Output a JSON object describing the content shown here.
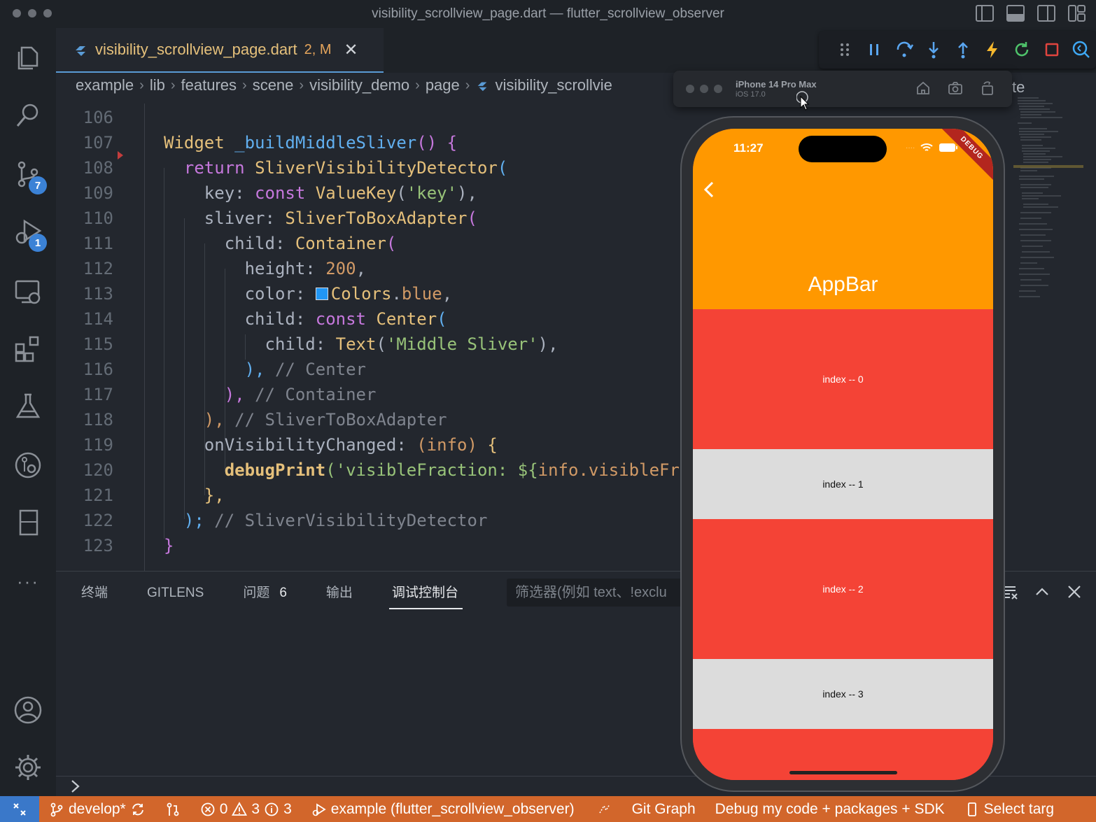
{
  "window": {
    "title": "visibility_scrollview_page.dart — flutter_scrollview_observer"
  },
  "activity_bar": {
    "source_control_badge": "7",
    "run_debug_badge": "1",
    "more": "···"
  },
  "tab": {
    "filename": "visibility_scrollview_page.dart",
    "status": "2, M",
    "close": "✕"
  },
  "breadcrumb": [
    "example",
    "lib",
    "features",
    "scene",
    "visibility_demo",
    "page",
    "visibility_scrollvie",
    "te"
  ],
  "code": {
    "line_numbers": [
      "106",
      "107",
      "108",
      "109",
      "110",
      "111",
      "112",
      "113",
      "114",
      "115",
      "116",
      "117",
      "118",
      "119",
      "120",
      "121",
      "122",
      "123"
    ],
    "l107": {
      "type": "Widget",
      "fn": "_buildMiddleSliver",
      "tail": "() {"
    },
    "l108": {
      "kw": "return",
      "type": "SliverVisibilityDetector",
      "tail": "("
    },
    "l109": {
      "prop": "key:",
      "kw": "const",
      "type": "ValueKey",
      "str": "'key'",
      "tail": "),"
    },
    "l110": {
      "prop": "sliver:",
      "type": "SliverToBoxAdapter",
      "tail": "("
    },
    "l111": {
      "prop": "child:",
      "type": "Container",
      "tail": "("
    },
    "l112": {
      "prop": "height:",
      "num": "200",
      "tail": ","
    },
    "l113": {
      "prop": "color:",
      "type": "Colors",
      "dot": ".",
      "val": "blue",
      "tail": ","
    },
    "l114": {
      "prop": "child:",
      "kw": "const",
      "type": "Center",
      "tail": "("
    },
    "l115": {
      "prop": "child:",
      "type": "Text",
      "str": "'Middle Sliver'",
      "tail": "),"
    },
    "l116": {
      "tail": "),",
      "comment": "// Center"
    },
    "l117": {
      "tail": "),",
      "comment": "// Container"
    },
    "l118": {
      "tail": "),",
      "comment": "// SliverToBoxAdapter"
    },
    "l119": {
      "prop": "onVisibilityChanged:",
      "param": "(info)",
      "tail": " {"
    },
    "l120": {
      "fn": "debugPrint",
      "str": "('visibleFraction: ${",
      "var": "info",
      "str2": ".visibleFr"
    },
    "l121": {
      "tail": "},"
    },
    "l122": {
      "tail": ");",
      "comment": "// SliverVisibilityDetector"
    },
    "l123": {
      "tail": "}"
    }
  },
  "panel": {
    "tabs": [
      "终端",
      "GITLENS",
      "问题",
      "输出",
      "调试控制台"
    ],
    "problems_count": "6",
    "active_tab": "调试控制台",
    "filter_placeholder": "筛选器(例如 text、!exclu",
    "prompt": ">"
  },
  "status_bar": {
    "branch": "develop*",
    "errors": "0",
    "warnings": "3",
    "infos": "3",
    "launch": "example (flutter_scrollview_observer)",
    "git_graph": "Git Graph",
    "debug_mode": "Debug my code + packages + SDK",
    "select_target": "Select targ"
  },
  "simulator": {
    "device": "iPhone 14 Pro Max",
    "os": "iOS 17.0",
    "time": "11:27",
    "debug_banner": "DEBUG",
    "appbar_title": "AppBar",
    "rows": [
      {
        "label": "index -- 0",
        "color": "#f44336"
      },
      {
        "label": "index -- 1",
        "color": "#dcdcdc"
      },
      {
        "label": "index -- 2",
        "color": "#f44336"
      },
      {
        "label": "index -- 3",
        "color": "#dcdcdc"
      }
    ]
  },
  "colors": {
    "status_bar": "#d2662b",
    "appbar": "#ff9800",
    "row_red": "#f44336",
    "row_grey": "#dcdcdc",
    "badge": "#3b82d6"
  }
}
